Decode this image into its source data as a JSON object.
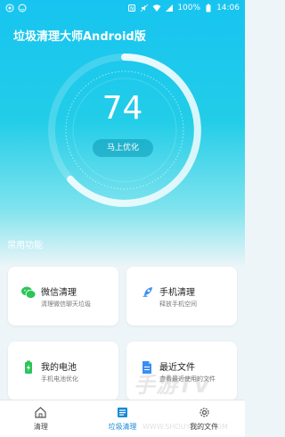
{
  "status_bar": {
    "battery": "100%",
    "time": "14:06"
  },
  "header": {
    "title": "垃圾清理大师Android版"
  },
  "gauge": {
    "score": "74",
    "button_label": "马上优化"
  },
  "section": {
    "title": "常用功能"
  },
  "cards": [
    {
      "title": "微信清理",
      "subtitle": "清理微信聊天垃圾",
      "icon": "wechat-icon",
      "color": "#2dc45a"
    },
    {
      "title": "手机清理",
      "subtitle": "释放手机空间",
      "icon": "rocket-icon",
      "color": "#3b8ef3"
    },
    {
      "title": "我的电池",
      "subtitle": "手机电池优化",
      "icon": "battery-icon",
      "color": "#2dc45a"
    },
    {
      "title": "最近文件",
      "subtitle": "查看最近使用的文件",
      "icon": "file-icon",
      "color": "#3b8ef3"
    }
  ],
  "tabs": [
    {
      "label": "清理",
      "icon": "home-icon",
      "active": false
    },
    {
      "label": "垃圾清理",
      "icon": "list-icon",
      "active": true
    },
    {
      "label": "我的文件",
      "icon": "gear-icon",
      "active": false
    }
  ],
  "watermark": {
    "brand": "手游TV",
    "url": "WWW.SHOUYOUTV.COM"
  },
  "colors": {
    "accent": "#1a8ad6",
    "hero_top": "#17c4f0"
  }
}
